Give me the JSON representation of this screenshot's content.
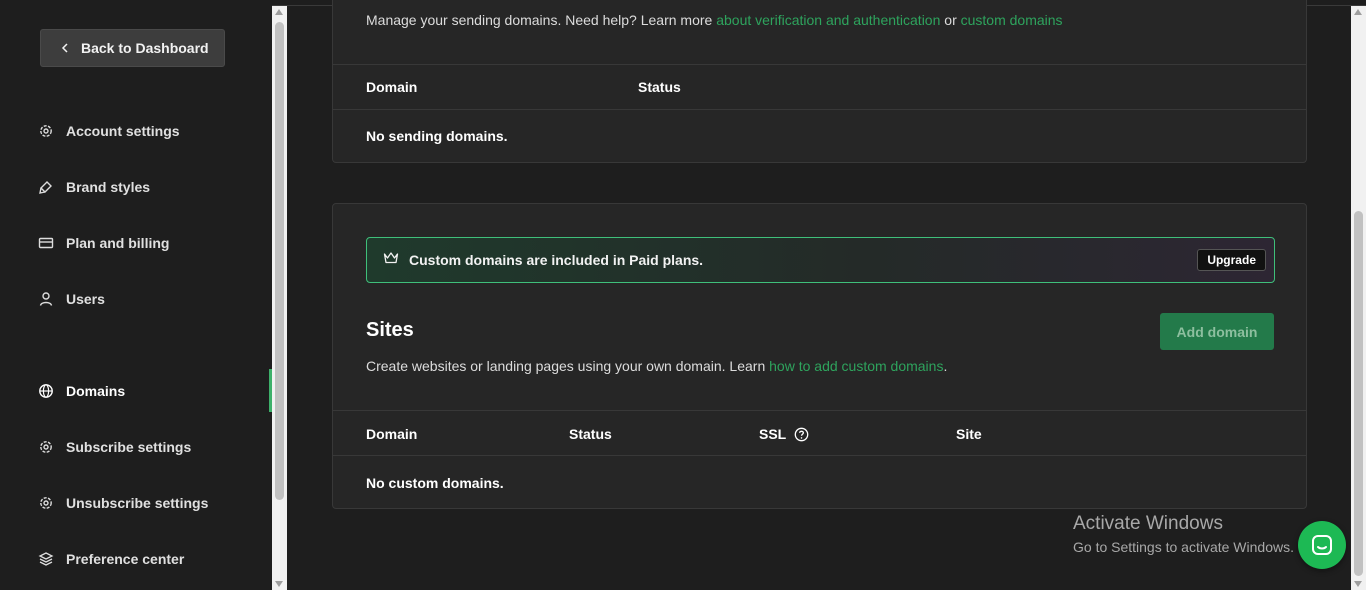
{
  "sidebar": {
    "back_label": "Back to Dashboard",
    "items": [
      {
        "label": "Account settings",
        "icon": "gear-icon"
      },
      {
        "label": "Brand styles",
        "icon": "brush-icon"
      },
      {
        "label": "Plan and billing",
        "icon": "credit-card-icon"
      },
      {
        "label": "Users",
        "icon": "user-icon"
      },
      {
        "label": "Domains",
        "icon": "globe-icon",
        "active": true
      },
      {
        "label": "Subscribe settings",
        "icon": "gear-icon"
      },
      {
        "label": "Unsubscribe settings",
        "icon": "gear-icon"
      },
      {
        "label": "Preference center",
        "icon": "layers-icon"
      }
    ]
  },
  "sending": {
    "desc_prefix": "Manage your sending domains. Need help? Learn more ",
    "link1": "about verification and authentication",
    "desc_or": " or ",
    "link2": "custom domains",
    "columns": [
      "Domain",
      "Status"
    ],
    "empty": "No sending domains."
  },
  "sites": {
    "banner_text": "Custom domains are included in Paid plans.",
    "upgrade_label": "Upgrade",
    "title": "Sites",
    "add_label": "Add domain",
    "desc_prefix": "Create websites or landing pages using your own domain. Learn ",
    "link": "how to add custom domains",
    "desc_suffix": ".",
    "columns": [
      "Domain",
      "Status",
      "SSL",
      "Site"
    ],
    "empty": "No custom domains."
  },
  "windows": {
    "title": "Activate Windows",
    "subtitle": "Go to Settings to activate Windows."
  },
  "colors": {
    "accent": "#2ea35d",
    "background": "#1e1e1e",
    "card": "#262626"
  }
}
